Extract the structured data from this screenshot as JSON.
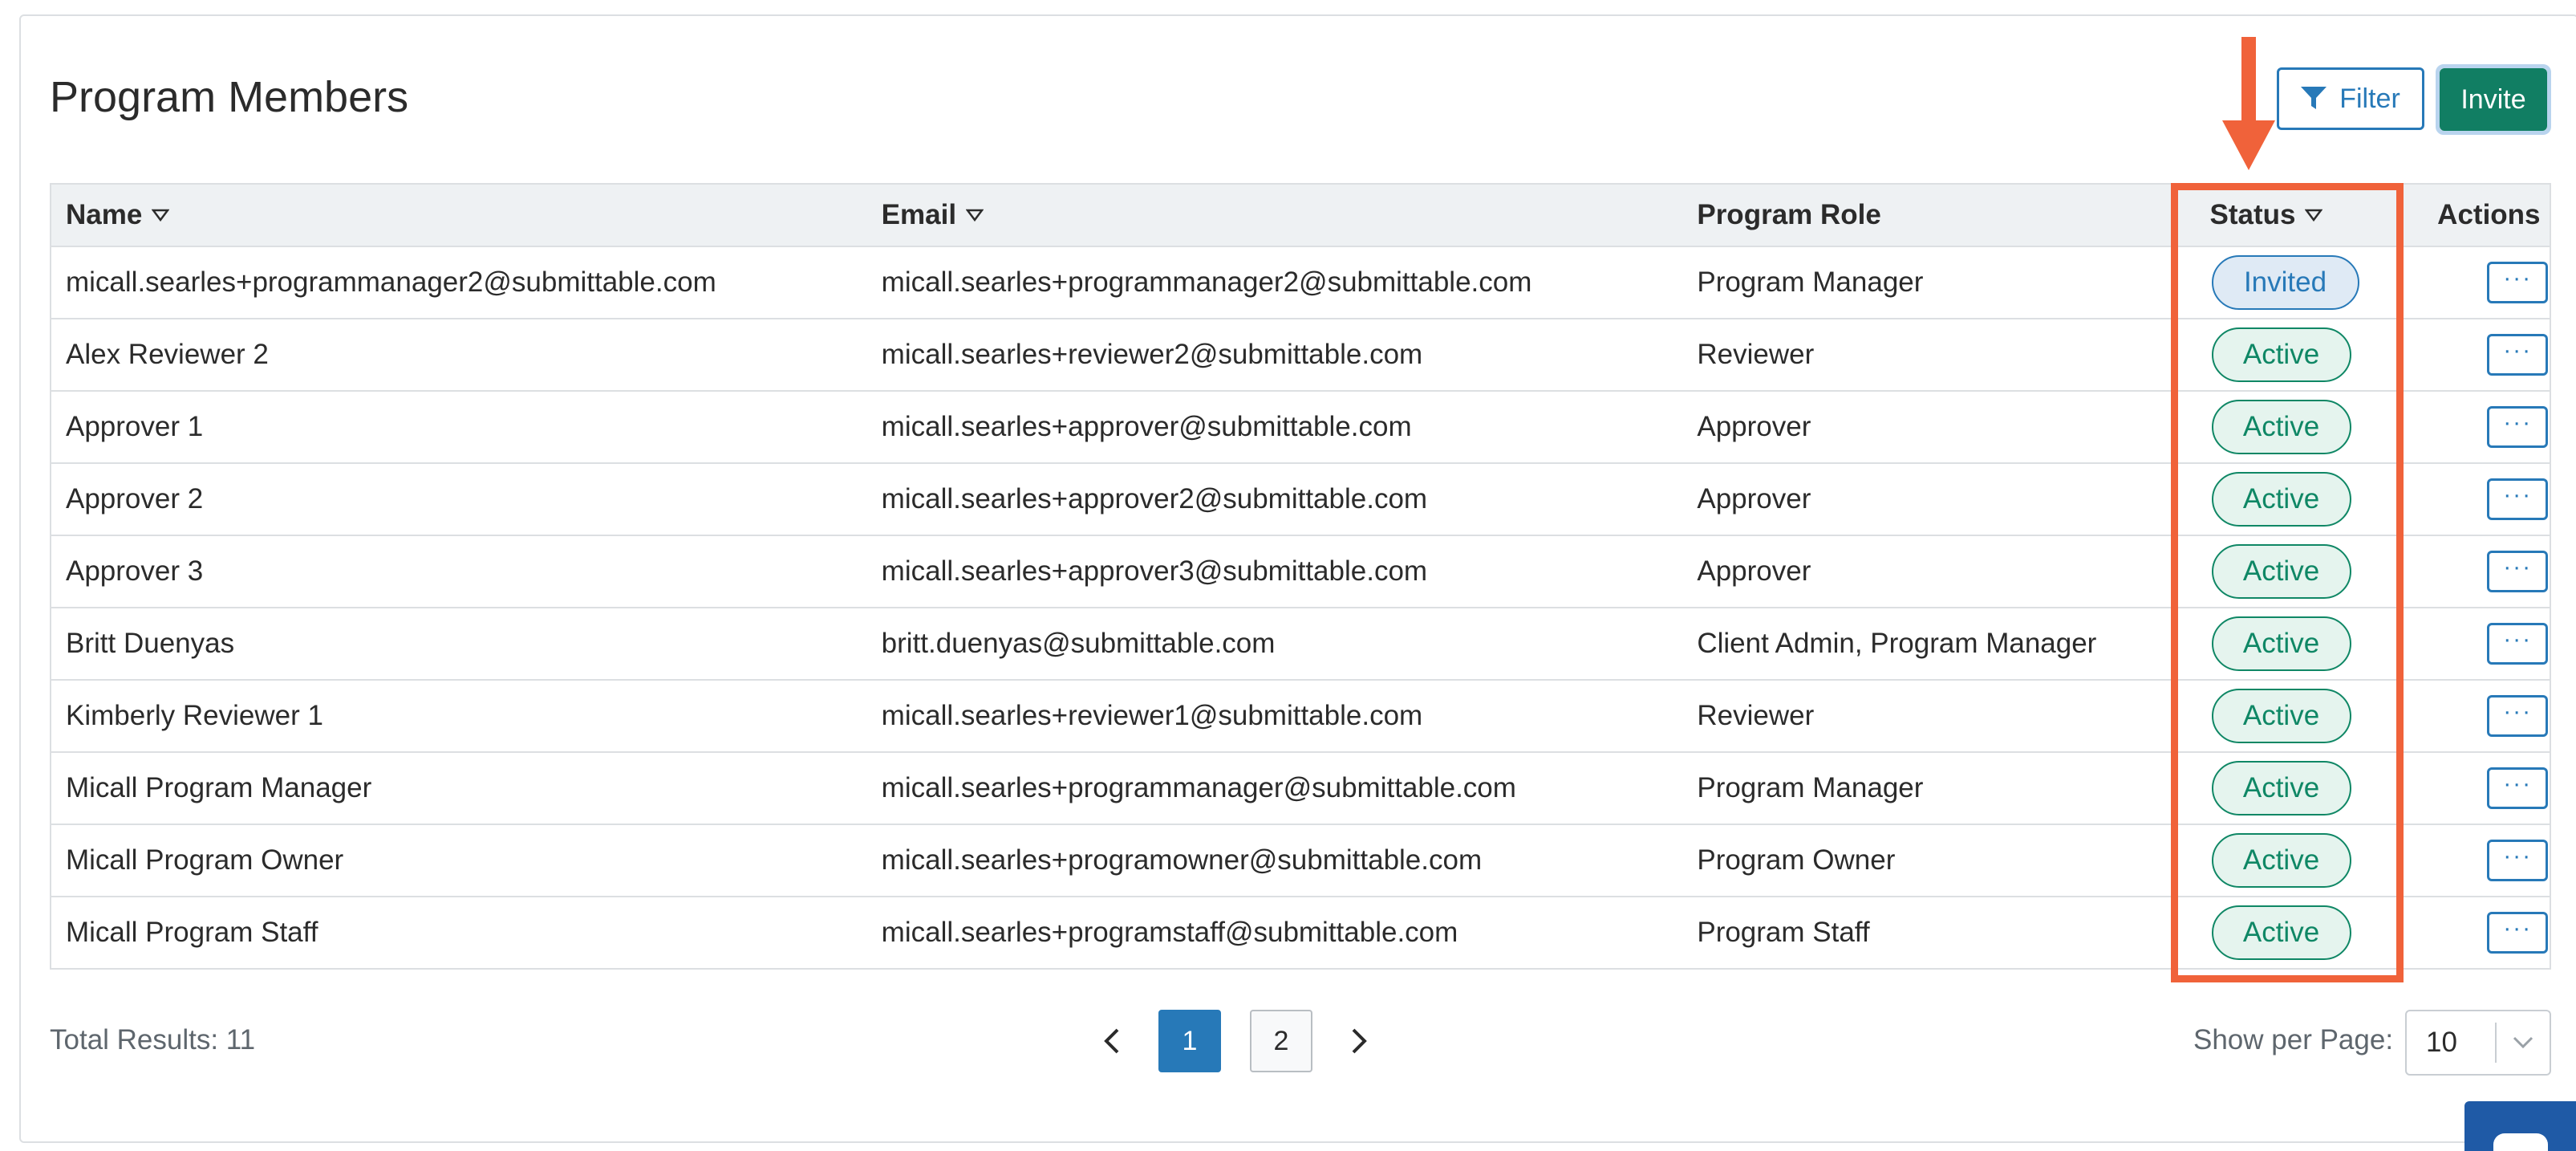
{
  "header": {
    "title": "Program Members",
    "filter_label": "Filter",
    "invite_label": "Invite"
  },
  "table": {
    "columns": {
      "name": "Name",
      "email": "Email",
      "role": "Program Role",
      "status": "Status",
      "actions": "Actions"
    },
    "rows": [
      {
        "name": "micall.searles+programmanager2@submittable.com",
        "email": "micall.searles+programmanager2@submittable.com",
        "role": "Program Manager",
        "status": "Invited"
      },
      {
        "name": "Alex Reviewer 2",
        "email": "micall.searles+reviewer2@submittable.com",
        "role": "Reviewer",
        "status": "Active"
      },
      {
        "name": "Approver 1",
        "email": "micall.searles+approver@submittable.com",
        "role": "Approver",
        "status": "Active"
      },
      {
        "name": "Approver 2",
        "email": "micall.searles+approver2@submittable.com",
        "role": "Approver",
        "status": "Active"
      },
      {
        "name": "Approver 3",
        "email": "micall.searles+approver3@submittable.com",
        "role": "Approver",
        "status": "Active"
      },
      {
        "name": "Britt Duenyas",
        "email": "britt.duenyas@submittable.com",
        "role": "Client Admin, Program Manager",
        "status": "Active"
      },
      {
        "name": "Kimberly Reviewer 1",
        "email": "micall.searles+reviewer1@submittable.com",
        "role": "Reviewer",
        "status": "Active"
      },
      {
        "name": "Micall Program Manager",
        "email": "micall.searles+programmanager@submittable.com",
        "role": "Program Manager",
        "status": "Active"
      },
      {
        "name": "Micall Program Owner",
        "email": "micall.searles+programowner@submittable.com",
        "role": "Program Owner",
        "status": "Active"
      },
      {
        "name": "Micall Program Staff",
        "email": "micall.searles+programstaff@submittable.com",
        "role": "Program Staff",
        "status": "Active"
      }
    ],
    "row_action_label": "···"
  },
  "footer": {
    "total_results": "Total Results: 11",
    "pages": [
      "1",
      "2"
    ],
    "current_page": "1",
    "per_page_label": "Show per Page:",
    "per_page_value": "10"
  },
  "icons": {
    "filter": "filter-funnel-icon",
    "sort": "sort-caret-icon",
    "prev": "chevron-left-icon",
    "next": "chevron-right-icon",
    "dropdown": "chevron-down-icon",
    "chat": "chat-icon"
  },
  "colors": {
    "primary_blue": "#2779b8",
    "invite_green": "#117e63",
    "active_green": "#0f8765",
    "annotation_orange": "#f0623a"
  }
}
